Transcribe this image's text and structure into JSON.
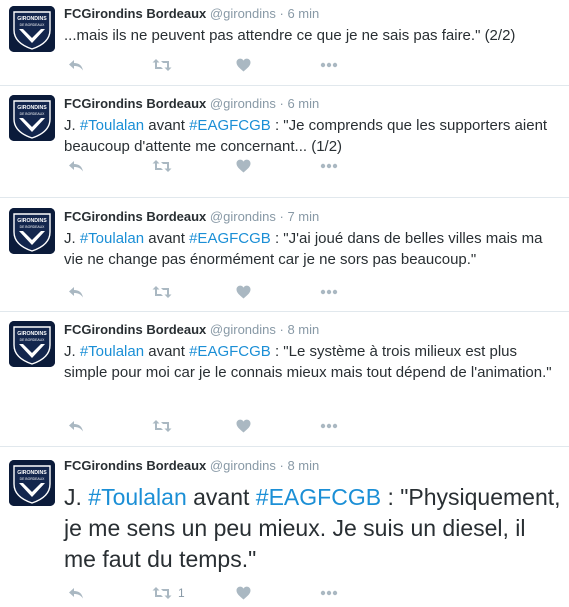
{
  "tweets": [
    {
      "name": "FCGirondins Bordeaux",
      "handle": "@girondins",
      "sep": "·",
      "time": "6 min",
      "text": "...mais ils ne peuvent pas attendre ce que je ne sais pas faire.\" (2/2)",
      "retweet_count": ""
    },
    {
      "name": "FCGirondins Bordeaux",
      "handle": "@girondins",
      "sep": "·",
      "time": "6 min",
      "prefix": "J. ",
      "tag1": "#Toulalan",
      "mid": " avant ",
      "tag2": "#EAGFCGB",
      "text": " : \"Je comprends que les supporters aient beaucoup d'attente me concernant... (1/2)",
      "retweet_count": ""
    },
    {
      "name": "FCGirondins Bordeaux",
      "handle": "@girondins",
      "sep": "·",
      "time": "7 min",
      "prefix": "J. ",
      "tag1": "#Toulalan",
      "mid": " avant ",
      "tag2": "#EAGFCGB",
      "text": " : \"J'ai joué dans de belles villes mais ma vie ne change pas énormément car je ne sors pas beaucoup.\"",
      "retweet_count": ""
    },
    {
      "name": "FCGirondins Bordeaux",
      "handle": "@girondins",
      "sep": "·",
      "time": "8 min",
      "prefix": "J. ",
      "tag1": "#Toulalan",
      "mid": " avant ",
      "tag2": "#EAGFCGB",
      "text": " : \"Le système à trois milieux est plus simple pour moi car je le connais mieux mais tout dépend de l'animation.\"",
      "retweet_count": ""
    },
    {
      "name": "FCGirondins Bordeaux",
      "handle": "@girondins",
      "sep": "·",
      "time": "8 min",
      "prefix": "J. ",
      "tag1": "#Toulalan",
      "mid": " avant ",
      "tag2": "#EAGFCGB",
      "text": " : \"Physiquement, je me sens un peu mieux. Je suis un diesel, il me faut du temps.\"",
      "retweet_count": "1"
    }
  ],
  "avatar": {
    "logo_text_top": "GIRONDINS",
    "logo_text_bottom": "DE BORDEAUX"
  },
  "colors": {
    "hashtag": "#1b8fd6",
    "muted": "#8899a6",
    "icon": "#aab8c2",
    "navy": "#0b1b3a"
  },
  "icons": [
    "reply-icon",
    "retweet-icon",
    "like-icon",
    "more-icon"
  ]
}
